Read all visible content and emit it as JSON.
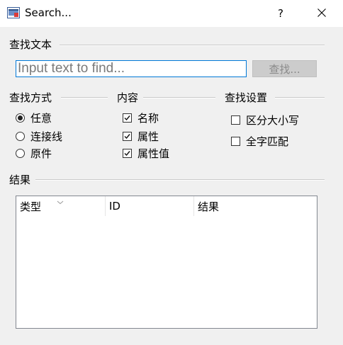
{
  "window": {
    "title": "Search...",
    "help_label": "?",
    "icon": "search-window-app-icon",
    "close_icon": "close-icon"
  },
  "find_text": {
    "label": "查找文本",
    "input_value": "",
    "input_placeholder": "Input text to find...",
    "find_button": "查找..."
  },
  "find_mode": {
    "label": "查找方式",
    "options": [
      {
        "label": "任意",
        "selected": true
      },
      {
        "label": "连接线",
        "selected": false
      },
      {
        "label": "原件",
        "selected": false
      }
    ]
  },
  "content": {
    "label": "内容",
    "options": [
      {
        "label": "名称",
        "checked": true
      },
      {
        "label": "属性",
        "checked": true
      },
      {
        "label": "属性值",
        "checked": true
      }
    ]
  },
  "find_settings": {
    "label": "查找设置",
    "options": [
      {
        "label": "区分大小写",
        "checked": false
      },
      {
        "label": "全字匹配",
        "checked": false
      }
    ]
  },
  "results": {
    "label": "结果",
    "columns": [
      "类型",
      "ID",
      "结果"
    ],
    "rows": []
  },
  "colors": {
    "background": "#f0f0f0",
    "titlebar": "#ffffff",
    "input_focus_border": "#0078d7",
    "disabled_button": "#cccccc"
  }
}
